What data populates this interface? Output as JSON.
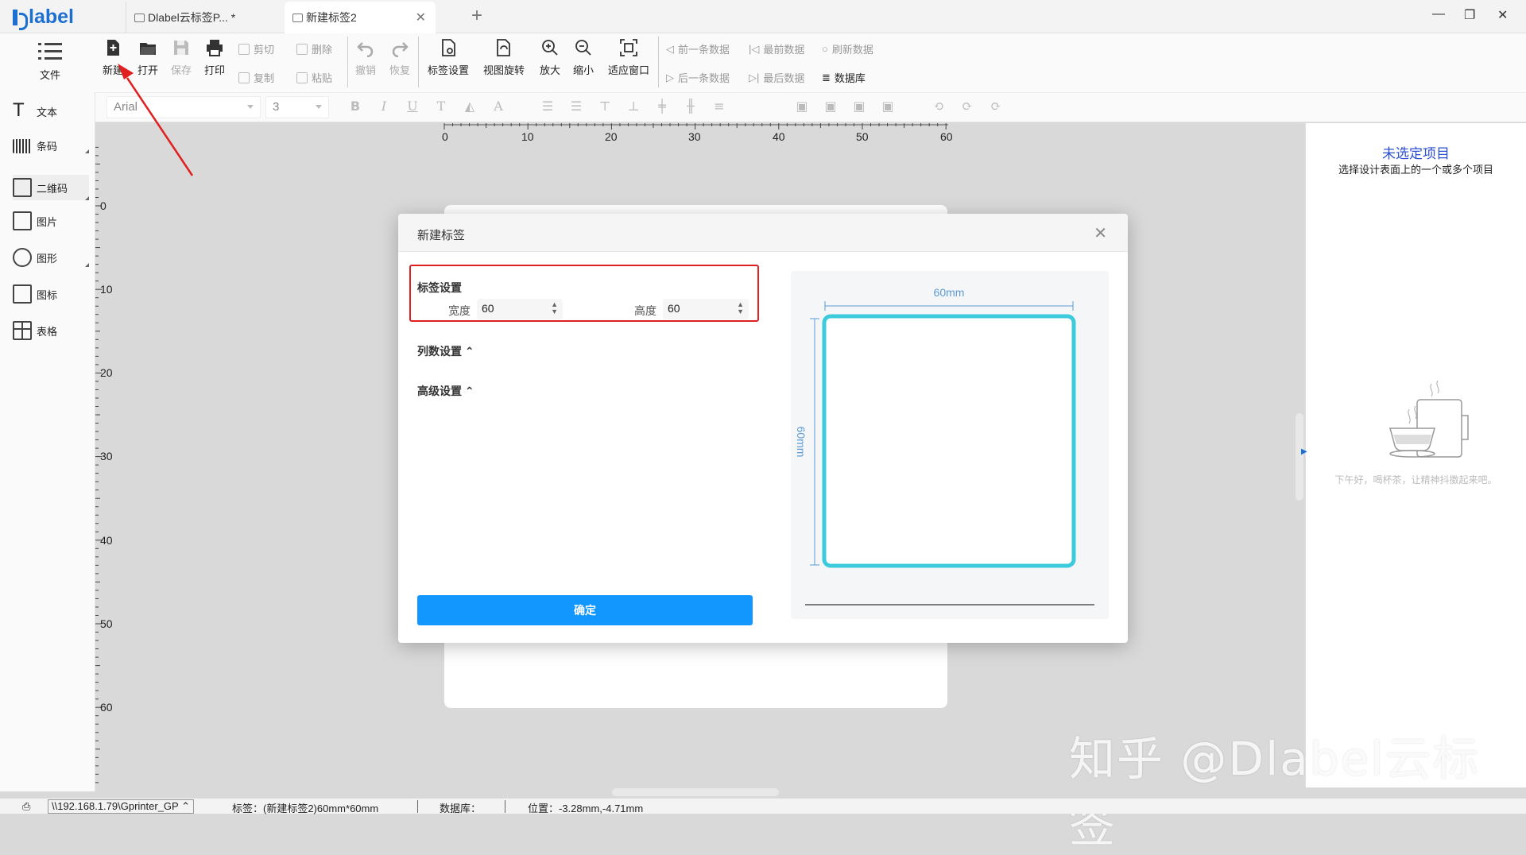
{
  "app": {
    "logo": "label"
  },
  "tabs": [
    {
      "label": "Dlabel云标签P... *"
    },
    {
      "label": "新建标签2"
    }
  ],
  "toolbar": {
    "file": "文件",
    "new": "新建",
    "open": "打开",
    "save": "保存",
    "print": "打印",
    "cut": "剪切",
    "copy": "复制",
    "delete": "删除",
    "paste": "粘贴",
    "undo": "撤销",
    "redo": "恢复",
    "label_settings": "标签设置",
    "view_rotate": "视图旋转",
    "zoom_in": "放大",
    "zoom_out": "缩小",
    "fit_window": "适应窗口",
    "prev_record": "前一条数据",
    "first_record": "最前数据",
    "refresh_data": "刷新数据",
    "next_record": "后一条数据",
    "last_record": "最后数据",
    "database": "数据库"
  },
  "format": {
    "font": "Arial",
    "size": "3"
  },
  "sidebar": [
    {
      "label": "文本",
      "icon": "text-icon"
    },
    {
      "label": "条码",
      "icon": "barcode-icon"
    },
    {
      "label": "二维码",
      "icon": "qrcode-icon"
    },
    {
      "label": "图片",
      "icon": "image-icon"
    },
    {
      "label": "图形",
      "icon": "shape-icon"
    },
    {
      "label": "图标",
      "icon": "symbol-icon"
    },
    {
      "label": "表格",
      "icon": "table-icon"
    }
  ],
  "ruler": {
    "top_ticks": [
      "0",
      "10",
      "20",
      "30",
      "40",
      "50",
      "60"
    ],
    "left_ticks": [
      "0",
      "10",
      "20",
      "30",
      "40",
      "50",
      "60"
    ]
  },
  "right_panel": {
    "title": "未选定项目",
    "subtitle": "选择设计表面上的一个或多个项目",
    "empty_text": "下午好，喝杯茶，让精神抖擞起来吧。"
  },
  "dialog": {
    "title": "新建标签",
    "label_settings": "标签设置",
    "width_label": "宽度",
    "width_value": "60",
    "height_label": "高度",
    "height_value": "60",
    "columns_settings": "列数设置",
    "advanced_settings": "高级设置",
    "confirm": "确定",
    "preview_width": "60mm",
    "preview_height": "60mm"
  },
  "watermark": "知乎 @Dlabel云标签",
  "status": {
    "printer": "\\\\192.168.1.79\\Gprinter_GP",
    "label": "标签：(新建标签2)60mm*60mm",
    "database": "数据库：",
    "position": "位置：-3.28mm,-4.71mm"
  },
  "colors": {
    "accent": "#1296ff",
    "preview_border": "#3ccbdc",
    "highlight": "#e02020"
  }
}
